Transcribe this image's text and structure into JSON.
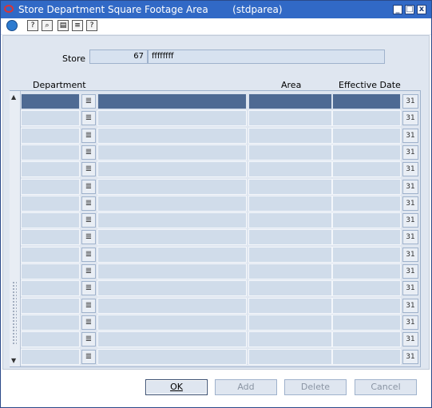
{
  "window": {
    "title": "Store Department Square Footage Area        (stdparea)",
    "controls": [
      "_",
      "□",
      "x"
    ]
  },
  "toolbar": {
    "icons": [
      "globe-icon",
      "help-info-icon",
      "zoom-icon",
      "clipboard-icon",
      "notes-icon",
      "help-icon"
    ]
  },
  "store": {
    "label": "Store",
    "number": "67",
    "name": "ffffffff"
  },
  "grid": {
    "columns": [
      "Department",
      "Area",
      "Effective Date"
    ],
    "row_count": 16,
    "selected_row": 0,
    "lov_glyph": "≣",
    "calendar_glyph": "31"
  },
  "buttons": {
    "ok": "OK",
    "add": "Add",
    "delete": "Delete",
    "cancel": "Cancel"
  }
}
